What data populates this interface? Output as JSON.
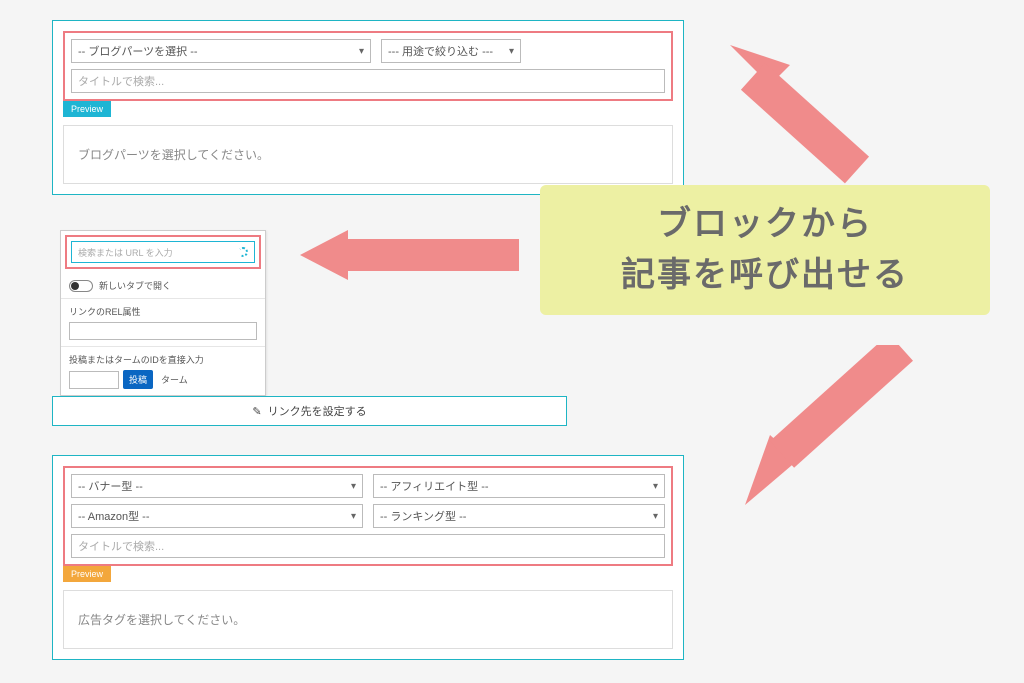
{
  "panel1": {
    "select_parts": "-- ブログパーツを選択 --",
    "select_purpose": "--- 用途で絞り込む ---",
    "title_search_placeholder": "タイトルで検索...",
    "preview_label": "Preview",
    "message": "ブログパーツを選択してください。"
  },
  "popup": {
    "search_placeholder": "検索または URL を入力",
    "toggle_label": "新しいタブで開く",
    "rel_label": "リンクのREL属性",
    "id_label": "投稿またはタームのIDを直接入力",
    "btn_post": "投稿",
    "btn_term": "ターム"
  },
  "linkbar": {
    "text": "リンク先を設定する"
  },
  "panel3": {
    "select_banner": "-- バナー型 --",
    "select_affiliate": "-- アフィリエイト型 --",
    "select_amazon": "-- Amazon型 --",
    "select_ranking": "-- ランキング型 --",
    "title_search_placeholder": "タイトルで検索...",
    "preview_label": "Preview",
    "message": "広告タグを選択してください。"
  },
  "callout": {
    "line1": "ブロックから",
    "line2": "記事を呼び出せる"
  },
  "colors": {
    "accent_teal": "#1eb5c4",
    "accent_red": "#ee7b82",
    "callout_bg": "#edf0a3",
    "arrow": "#f08b8b",
    "preview_blue": "#1eb5d4",
    "preview_orange": "#f3a73c"
  }
}
